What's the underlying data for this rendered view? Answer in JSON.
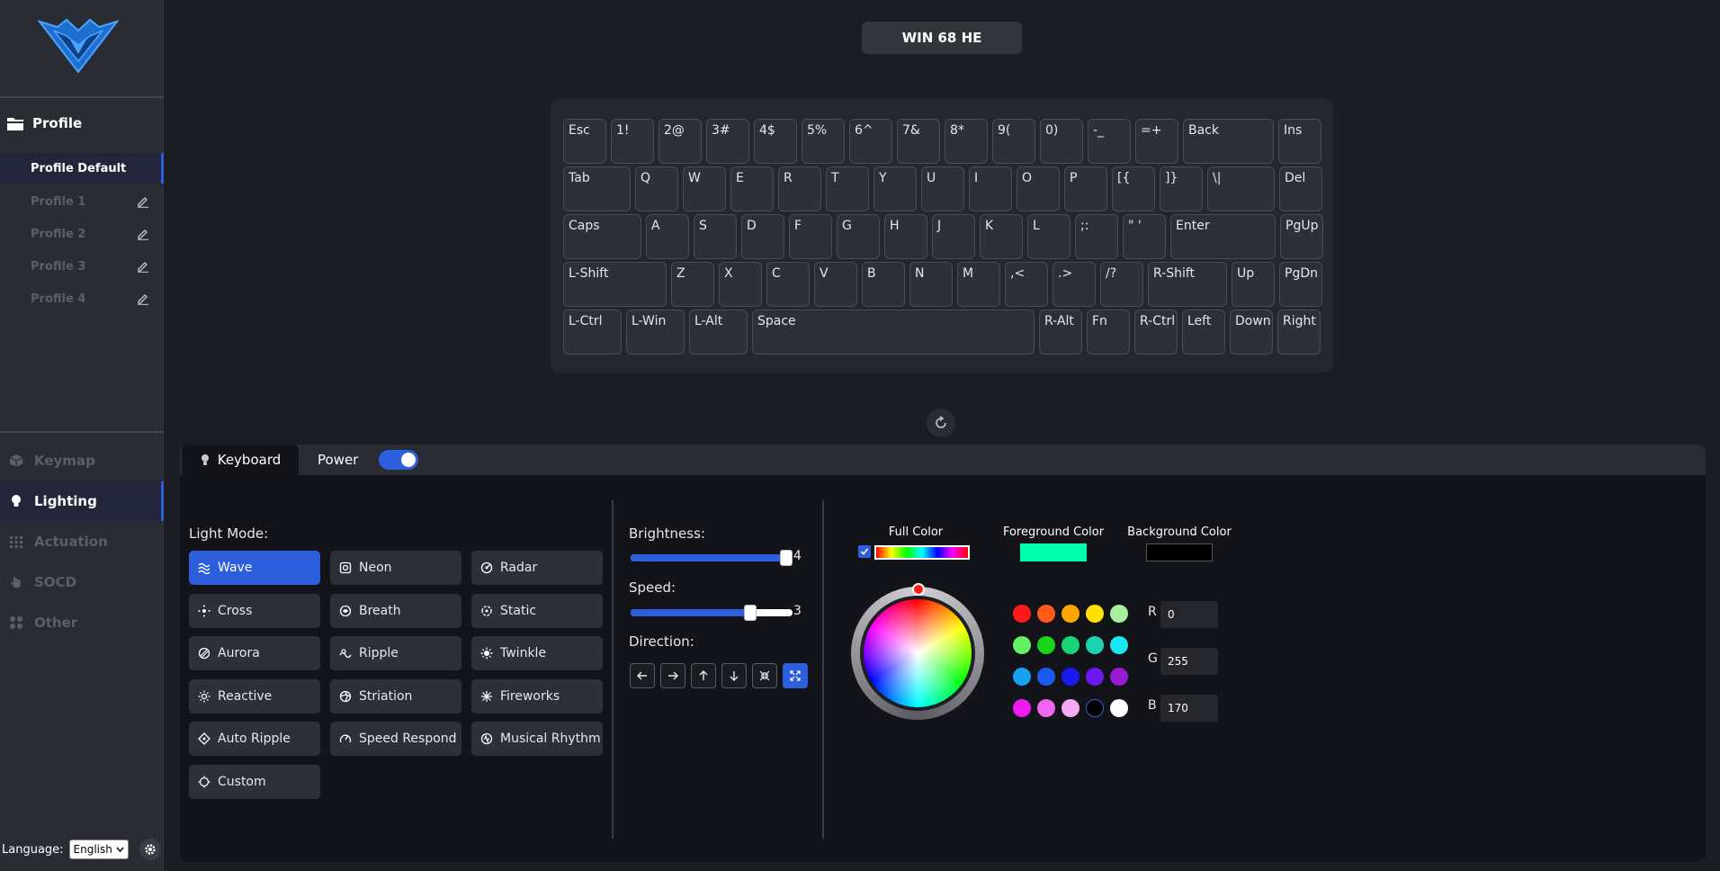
{
  "device": {
    "title": "WIN 68 HE"
  },
  "sidebar": {
    "profile_header": "Profile",
    "profiles": [
      {
        "label": "Profile Default",
        "active": true
      },
      {
        "label": "Profile 1"
      },
      {
        "label": "Profile 2"
      },
      {
        "label": "Profile 3"
      },
      {
        "label": "Profile 4"
      }
    ],
    "nav": [
      {
        "label": "Keymap",
        "icon": "cube-icon"
      },
      {
        "label": "Lighting",
        "icon": "bulb-icon",
        "active": true
      },
      {
        "label": "Actuation",
        "icon": "grid-icon"
      },
      {
        "label": "SOCD",
        "icon": "hand-icon"
      },
      {
        "label": "Other",
        "icon": "apps-icon"
      }
    ],
    "language_label": "Language:",
    "language_value": "English"
  },
  "keyboard": {
    "rows": [
      [
        "Esc",
        "1!",
        "2@",
        "3#",
        "4$",
        "5%",
        "6^",
        "7&",
        "8*",
        "9(",
        "0)",
        "-_",
        "=+",
        "Back",
        "Ins"
      ],
      [
        "Tab",
        "Q",
        "W",
        "E",
        "R",
        "T",
        "Y",
        "U",
        "I",
        "O",
        "P",
        "[{",
        "]}",
        "\\|",
        "Del"
      ],
      [
        "Caps",
        "A",
        "S",
        "D",
        "F",
        "G",
        "H",
        "J",
        "K",
        "L",
        ";:",
        "\" '",
        "Enter",
        "PgUp"
      ],
      [
        "L-Shift",
        "Z",
        "X",
        "C",
        "V",
        "B",
        "N",
        "M",
        ",<",
        ".>",
        "/?",
        "R-Shift",
        "Up",
        "PgDn"
      ],
      [
        "L-Ctrl",
        "L-Win",
        "L-Alt",
        "Space",
        "R-Alt",
        "Fn",
        "R-Ctrl",
        "Left",
        "Down",
        "Right"
      ]
    ]
  },
  "tabs": {
    "keyboard": "Keyboard",
    "power": "Power"
  },
  "power_on": true,
  "light_mode": {
    "label": "Light Mode:",
    "modes": [
      {
        "label": "Wave",
        "icon": "wave-icon",
        "active": true
      },
      {
        "label": "Neon",
        "icon": "neon-icon"
      },
      {
        "label": "Radar",
        "icon": "radar-icon"
      },
      {
        "label": "Cross",
        "icon": "cross-icon"
      },
      {
        "label": "Breath",
        "icon": "breath-icon"
      },
      {
        "label": "Static",
        "icon": "static-icon"
      },
      {
        "label": "Aurora",
        "icon": "aurora-icon"
      },
      {
        "label": "Ripple",
        "icon": "ripple-icon"
      },
      {
        "label": "Twinkle",
        "icon": "twinkle-icon"
      },
      {
        "label": "Reactive",
        "icon": "reactive-icon"
      },
      {
        "label": "Striation",
        "icon": "striation-icon"
      },
      {
        "label": "Fireworks",
        "icon": "fireworks-icon"
      },
      {
        "label": "Auto Ripple",
        "icon": "auto-ripple-icon"
      },
      {
        "label": "Speed Respond",
        "icon": "speed-respond-icon"
      },
      {
        "label": "Musical Rhythm",
        "icon": "musical-rhythm-icon"
      },
      {
        "label": "Custom",
        "icon": "custom-icon"
      }
    ]
  },
  "brightness": {
    "label": "Brightness:",
    "value": "4",
    "fraction": 0.96
  },
  "speed": {
    "label": "Speed:",
    "value": "3",
    "fraction": 0.74
  },
  "direction": {
    "label": "Direction:",
    "buttons": [
      {
        "icon": "arrow-left-icon"
      },
      {
        "icon": "arrow-right-icon"
      },
      {
        "icon": "arrow-up-icon"
      },
      {
        "icon": "arrow-down-icon"
      },
      {
        "icon": "collapse-icon"
      },
      {
        "icon": "expand-icon",
        "active": true
      }
    ]
  },
  "colors": {
    "full_color_label": "Full Color",
    "foreground_label": "Foreground Color",
    "background_label": "Background Color",
    "foreground": "#00ffaa",
    "background": "#000000",
    "accent": "#2d5fdc",
    "presets": [
      "#ff1a1a",
      "#ff5a1a",
      "#ffa500",
      "#ffe000",
      "#a8f0a0",
      "#66ee66",
      "#1ad41a",
      "#1ad47a",
      "#1ad4b0",
      "#1ae8f0",
      "#1aa0f0",
      "#1a5af0",
      "#1a1af0",
      "#6a1af0",
      "#9a1ad0",
      "#ee1aee",
      "#f066f0",
      "#f5aaf5",
      "#000000",
      "#ffffff"
    ],
    "r": "0",
    "g": "255",
    "b": "170",
    "r_label": "R",
    "g_label": "G",
    "b_label": "B"
  }
}
